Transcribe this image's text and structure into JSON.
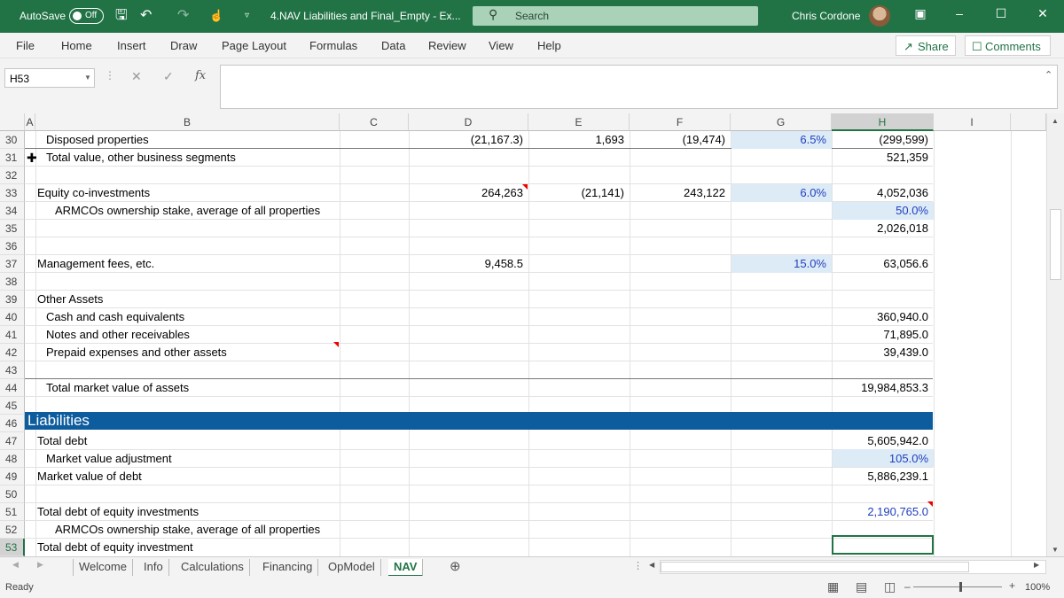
{
  "titlebar": {
    "autosave_label": "AutoSave",
    "autosave_state": "Off",
    "doc_title": "4.NAV Liabilities and Final_Empty  -  Ex...",
    "search_placeholder": "Search",
    "user_name": "Chris Cordone",
    "icons": [
      "save-icon",
      "undo-icon",
      "redo-icon",
      "touch-mode-icon",
      "customize-qat-icon"
    ]
  },
  "ribbon": {
    "tabs": [
      "File",
      "Home",
      "Insert",
      "Draw",
      "Page Layout",
      "Formulas",
      "Data",
      "Review",
      "View",
      "Help"
    ],
    "share_label": "Share",
    "comments_label": "Comments"
  },
  "formula_bar": {
    "name_box": "H53",
    "fx": "fx",
    "content": ""
  },
  "columns": [
    "A",
    "B",
    "C",
    "D",
    "E",
    "F",
    "G",
    "H",
    "I"
  ],
  "rows": [
    "30",
    "31",
    "32",
    "33",
    "34",
    "35",
    "36",
    "37",
    "38",
    "39",
    "40",
    "41",
    "42",
    "43",
    "44",
    "45",
    "46",
    "47",
    "48",
    "49",
    "50",
    "51",
    "52",
    "53"
  ],
  "cells": {
    "r30": {
      "b": "Disposed properties",
      "d": "(21,167.3)",
      "e": "1,693",
      "f": "(19,474)",
      "g": "6.5%",
      "h": "(299,599)"
    },
    "r31": {
      "b": "Total value, other business segments",
      "h": "521,359"
    },
    "r33": {
      "b": "Equity co-investments",
      "d": "264,263",
      "e": "(21,141)",
      "f": "243,122",
      "g": "6.0%",
      "h": "4,052,036"
    },
    "r34": {
      "b": "ARMCOs ownership stake, average of all properties",
      "h": "50.0%"
    },
    "r35": {
      "h": "2,026,018"
    },
    "r37": {
      "b": "Management fees, etc.",
      "d": "9,458.5",
      "g": "15.0%",
      "h": "63,056.6"
    },
    "r39": {
      "b": "Other Assets"
    },
    "r40": {
      "b": "Cash and cash equivalents",
      "h": "360,940.0"
    },
    "r41": {
      "b": "Notes and other receivables",
      "h": "71,895.0"
    },
    "r42": {
      "b": "Prepaid expenses and other assets",
      "h": "39,439.0"
    },
    "r44": {
      "b": "Total market value of assets",
      "h": "19,984,853.3"
    },
    "r46": {
      "a": "Liabilities"
    },
    "r47": {
      "b": "Total debt",
      "h": "5,605,942.0"
    },
    "r48": {
      "b": "Market value adjustment",
      "h": "105.0%"
    },
    "r49": {
      "b": "Market value of debt",
      "h": "5,886,239.1"
    },
    "r51": {
      "b": "Total debt of equity investments",
      "h": "2,190,765.0"
    },
    "r52": {
      "b": "ARMCOs ownership stake, average of all properties"
    },
    "r53": {
      "b": "Total debt of equity investment"
    }
  },
  "sheets": [
    "Welcome",
    "Info",
    "Calculations",
    "Financing",
    "OpModel",
    "NAV"
  ],
  "active_sheet": "NAV",
  "status": {
    "ready": "Ready",
    "zoom": "100%"
  },
  "colors": {
    "excel_green": "#217346",
    "section_band": "#0d5c9e",
    "input_fill": "#ddebf7",
    "input_text": "#1f3fbf"
  }
}
